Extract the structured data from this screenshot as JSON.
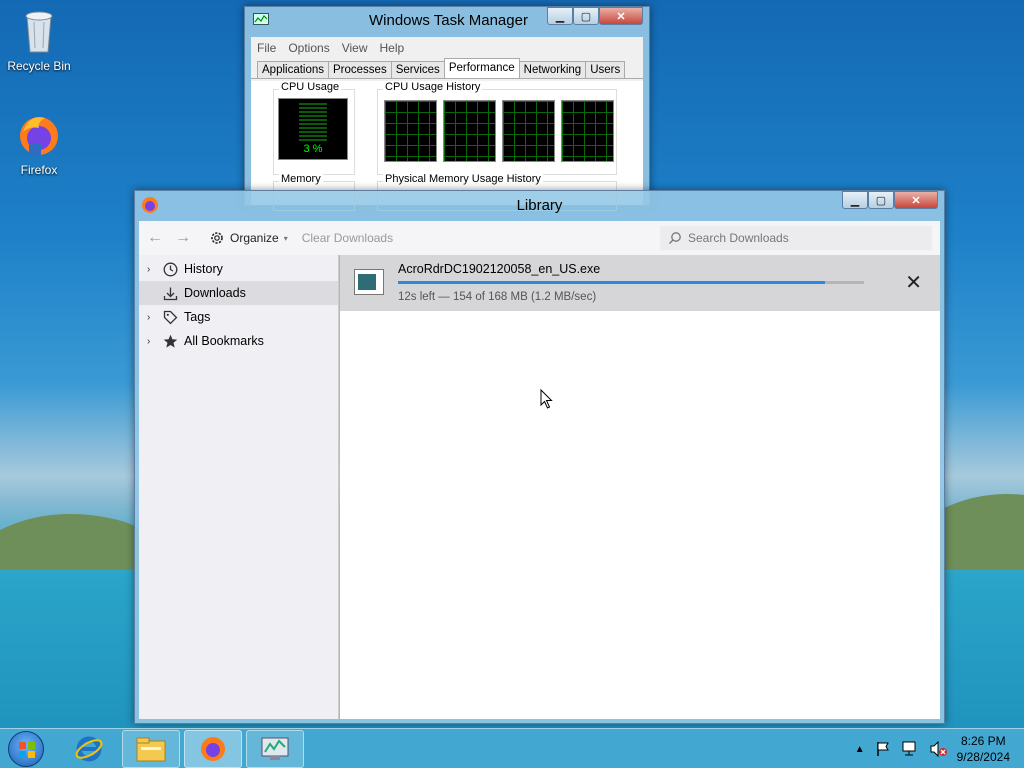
{
  "desktop": {
    "icons": [
      {
        "label": "Recycle Bin"
      },
      {
        "label": "Firefox"
      }
    ]
  },
  "task_manager": {
    "title": "Windows Task Manager",
    "menu": [
      "File",
      "Options",
      "View",
      "Help"
    ],
    "tabs": [
      "Applications",
      "Processes",
      "Services",
      "Performance",
      "Networking",
      "Users"
    ],
    "active_tab": "Performance",
    "cpu_usage_label": "CPU Usage",
    "cpu_usage_value": "3 %",
    "cpu_history_label": "CPU Usage History",
    "memory_label": "Memory",
    "physical_memory_label": "Physical Memory Usage History"
  },
  "library": {
    "title": "Library",
    "toolbar": {
      "organize_label": "Organize",
      "clear_downloads_label": "Clear Downloads",
      "search_placeholder": "Search Downloads"
    },
    "sidebar": [
      {
        "label": "History",
        "icon": "clock-icon"
      },
      {
        "label": "Downloads",
        "icon": "download-icon"
      },
      {
        "label": "Tags",
        "icon": "tag-icon"
      },
      {
        "label": "All Bookmarks",
        "icon": "star-icon"
      }
    ],
    "download": {
      "filename": "AcroRdrDC1902120058_en_US.exe",
      "status": "12s left — 154 of 168 MB (1.2 MB/sec)",
      "progress": 0.917
    }
  },
  "taskbar": {
    "clock_time": "8:26 PM",
    "clock_date": "9/28/2024"
  },
  "colors": {
    "accent": "#2a8ae0",
    "graph_line": "#00ff00"
  }
}
